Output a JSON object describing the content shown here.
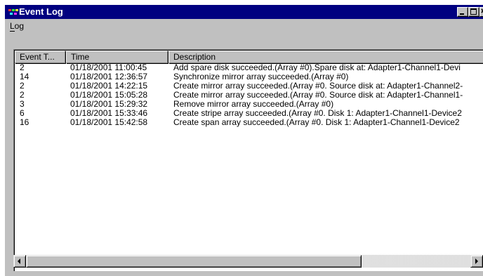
{
  "window": {
    "title": "Event Log",
    "title_bar_color": "#000080"
  },
  "menubar": {
    "items": [
      {
        "label": "Log"
      }
    ]
  },
  "listview": {
    "columns": [
      "Event T...",
      "Time",
      "Description"
    ],
    "rows": [
      {
        "event_type": "2",
        "time": "01/18/2001 11:00:45",
        "description": "Add spare disk succeeded.(Array #0).Spare disk at: Adapter1-Channel1-Devi"
      },
      {
        "event_type": "14",
        "time": "01/18/2001 12:36:57",
        "description": "Synchronize mirror array succeeded.(Array #0)"
      },
      {
        "event_type": "2",
        "time": "01/18/2001 14:22:15",
        "description": "Create mirror array succeeded.(Array #0. Source disk at: Adapter1-Channel2-"
      },
      {
        "event_type": "2",
        "time": "01/18/2001 15:05:28",
        "description": "Create mirror array succeeded.(Array #0. Source disk at: Adapter1-Channel1-"
      },
      {
        "event_type": "3",
        "time": "01/18/2001 15:29:32",
        "description": "Remove mirror array succeeded.(Array #0)"
      },
      {
        "event_type": "6",
        "time": "01/18/2001 15:33:46",
        "description": "Create stripe array succeeded.(Array #0. Disk 1: Adapter1-Channel1-Device2"
      },
      {
        "event_type": "16",
        "time": "01/18/2001 15:42:58",
        "description": "Create span array succeeded.(Array #0. Disk 1: Adapter1-Channel1-Device2"
      }
    ]
  }
}
